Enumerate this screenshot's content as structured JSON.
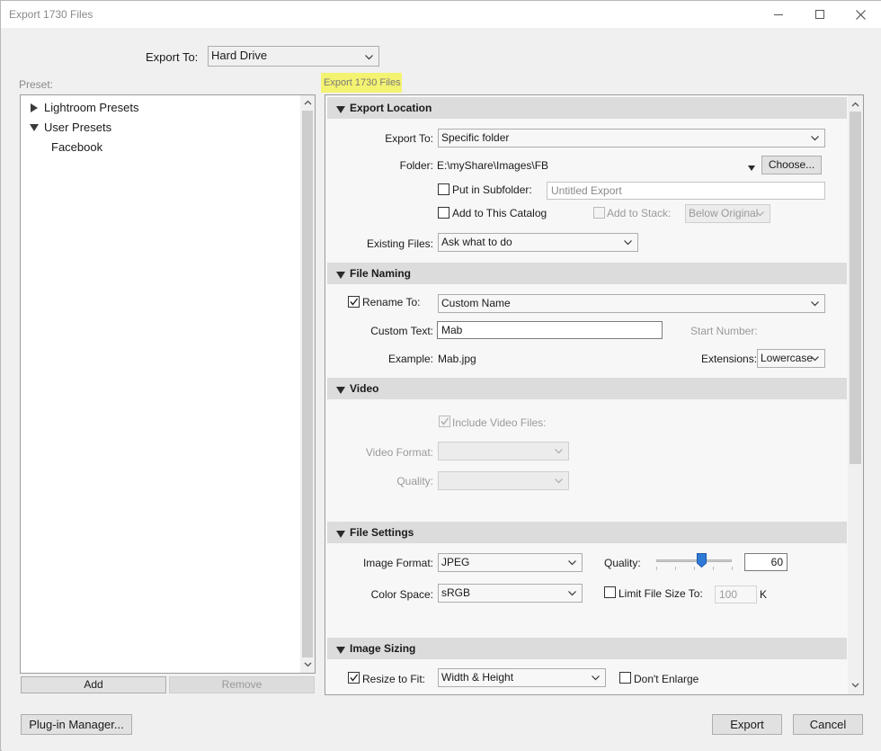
{
  "window": {
    "title": "Export 1730 Files"
  },
  "top": {
    "export_to_label": "Export To:",
    "export_to_value": "Hard Drive"
  },
  "preset": {
    "label": "Preset:",
    "items": [
      "Lightroom Presets",
      "User Presets",
      "Facebook"
    ],
    "add_label": "Add",
    "remove_label": "Remove"
  },
  "panel_header": "Export 1730 Files",
  "export_location": {
    "title": "Export Location",
    "export_to_label": "Export To:",
    "export_to_value": "Specific folder",
    "folder_label": "Folder:",
    "folder_value": "E:\\myShare\\Images\\FB",
    "choose_label": "Choose...",
    "subfolder_label": "Put in Subfolder:",
    "subfolder_placeholder": "Untitled Export",
    "add_catalog_label": "Add to This Catalog",
    "add_stack_label": "Add to Stack:",
    "stack_value": "Below Original",
    "existing_label": "Existing Files:",
    "existing_value": "Ask what to do"
  },
  "file_naming": {
    "title": "File Naming",
    "rename_label": "Rename To:",
    "rename_value": "Custom Name",
    "custom_text_label": "Custom Text:",
    "custom_text_value": "Mab",
    "start_number_label": "Start Number:",
    "example_label": "Example:",
    "example_value": "Mab.jpg",
    "extensions_label": "Extensions:",
    "extensions_value": "Lowercase"
  },
  "video": {
    "title": "Video",
    "include_label": "Include Video Files:",
    "format_label": "Video Format:",
    "quality_label": "Quality:"
  },
  "file_settings": {
    "title": "File Settings",
    "format_label": "Image Format:",
    "format_value": "JPEG",
    "quality_label": "Quality:",
    "quality_value": "60",
    "quality_level": 0.6,
    "color_space_label": "Color Space:",
    "color_space_value": "sRGB",
    "limit_label": "Limit File Size To:",
    "limit_value": "100",
    "limit_unit": "K"
  },
  "image_sizing": {
    "title": "Image Sizing",
    "resize_label": "Resize to Fit:",
    "resize_value": "Width & Height",
    "dont_enlarge_label": "Don't Enlarge"
  },
  "footer": {
    "plugin_label": "Plug-in Manager...",
    "export_label": "Export",
    "cancel_label": "Cancel"
  },
  "colors": {
    "highlight": "#f4f371",
    "thumb": "#2f7ad6"
  }
}
